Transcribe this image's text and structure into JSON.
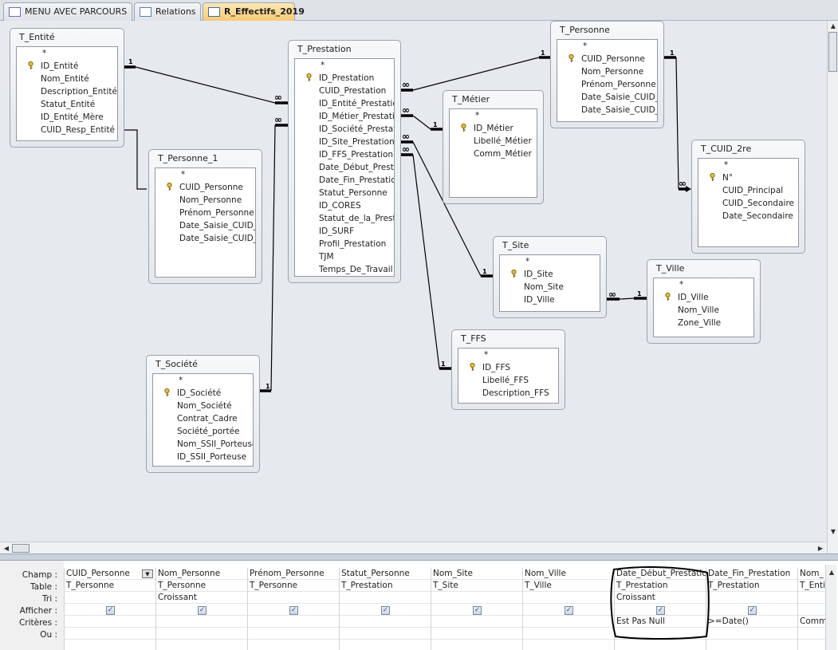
{
  "tabs": [
    {
      "label": "MENU AVEC PARCOURS",
      "icon": "form-icon"
    },
    {
      "label": "Relations",
      "icon": "relations-icon"
    },
    {
      "label": "R_Effectifs_2019",
      "icon": "query-icon",
      "active": true
    }
  ],
  "tables": [
    {
      "id": "entite",
      "title": "T_Entité",
      "fields": [
        "*",
        "ID_Entité",
        "Nom_Entité",
        "Description_Entité",
        "Statut_Entité",
        "ID_Entité_Mère",
        "CUID_Resp_Entité"
      ],
      "key": "ID_Entité"
    },
    {
      "id": "personne1",
      "title": "T_Personne_1",
      "fields": [
        "*",
        "CUID_Personne",
        "Nom_Personne",
        "Prénom_Personne",
        "Date_Saisie_CUID_C",
        "Date_Saisie_CUID_T"
      ],
      "key": "CUID_Personne"
    },
    {
      "id": "prestation",
      "title": "T_Prestation",
      "fields": [
        "*",
        "ID_Prestation",
        "CUID_Prestation",
        "ID_Entité_Prestation",
        "ID_Métier_Prestation",
        "ID_Société_Prestation",
        "ID_Site_Prestation",
        "ID_FFS_Prestation",
        "Date_Début_Prestation",
        "Date_Fin_Prestation",
        "Statut_Personne",
        "ID_CORES",
        "Statut_de_la_Prestation",
        "ID_SURF",
        "Profil_Prestation",
        "TJM",
        "Temps_De_Travail"
      ],
      "key": "ID_Prestation"
    },
    {
      "id": "personne",
      "title": "T_Personne",
      "fields": [
        "*",
        "CUID_Personne",
        "Nom_Personne",
        "Prénom_Personne",
        "Date_Saisie_CUID_C",
        "Date_Saisie_CUID_T"
      ],
      "key": "CUID_Personne"
    },
    {
      "id": "metier",
      "title": "T_Métier",
      "fields": [
        "*",
        "ID_Métier",
        "Libellé_Métier",
        "Comm_Métier"
      ],
      "key": "ID_Métier"
    },
    {
      "id": "cuid2re",
      "title": "T_CUID_2re",
      "fields": [
        "*",
        "N°",
        "CUID_Principal",
        "CUID_Secondaire",
        "Date_Secondaire"
      ],
      "key": "N°"
    },
    {
      "id": "site",
      "title": "T_Site",
      "fields": [
        "*",
        "ID_Site",
        "Nom_Site",
        "ID_Ville"
      ],
      "key": "ID_Site"
    },
    {
      "id": "ville",
      "title": "T_Ville",
      "fields": [
        "*",
        "ID_Ville",
        "Nom_Ville",
        "Zone_Ville"
      ],
      "key": "ID_Ville"
    },
    {
      "id": "ffs",
      "title": "T_FFS",
      "fields": [
        "*",
        "ID_FFS",
        "Libellé_FFS",
        "Description_FFS"
      ],
      "key": "ID_FFS"
    },
    {
      "id": "societe",
      "title": "T_Société",
      "fields": [
        "*",
        "ID_Société",
        "Nom_Société",
        "Contrat_Cadre",
        "Société_portée",
        "Nom_SSII_Porteuse",
        "ID_SSII_Porteuse"
      ],
      "key": "ID_Société"
    }
  ],
  "relation_labels": {
    "one": "1",
    "many": "∞"
  },
  "grid": {
    "row_labels": [
      "Champ :",
      "Table :",
      "Tri :",
      "Afficher :",
      "Critères :",
      "Ou :"
    ],
    "columns": [
      {
        "champ": "CUID_Personne",
        "table": "T_Personne",
        "tri": "",
        "afficher": true,
        "criteres": "",
        "ou": ""
      },
      {
        "champ": "Nom_Personne",
        "table": "T_Personne",
        "tri": "Croissant",
        "afficher": true,
        "criteres": "",
        "ou": ""
      },
      {
        "champ": "Prénom_Personne",
        "table": "T_Personne",
        "tri": "",
        "afficher": true,
        "criteres": "",
        "ou": ""
      },
      {
        "champ": "Statut_Personne",
        "table": "T_Prestation",
        "tri": "",
        "afficher": true,
        "criteres": "",
        "ou": ""
      },
      {
        "champ": "Nom_Site",
        "table": "T_Site",
        "tri": "",
        "afficher": true,
        "criteres": "",
        "ou": ""
      },
      {
        "champ": "Nom_Ville",
        "table": "T_Ville",
        "tri": "",
        "afficher": true,
        "criteres": "",
        "ou": ""
      },
      {
        "champ": "Date_Début_Prestation",
        "table": "T_Prestation",
        "tri": "Croissant",
        "afficher": true,
        "criteres": "Est Pas Null",
        "ou": ""
      },
      {
        "champ": "Date_Fin_Prestation",
        "table": "T_Prestation",
        "tri": "",
        "afficher": true,
        "criteres": ">=Date()",
        "ou": ""
      },
      {
        "champ": "Nom_",
        "table": "T_Enti",
        "tri": "",
        "afficher": null,
        "criteres": "Comm",
        "ou": ""
      }
    ]
  }
}
